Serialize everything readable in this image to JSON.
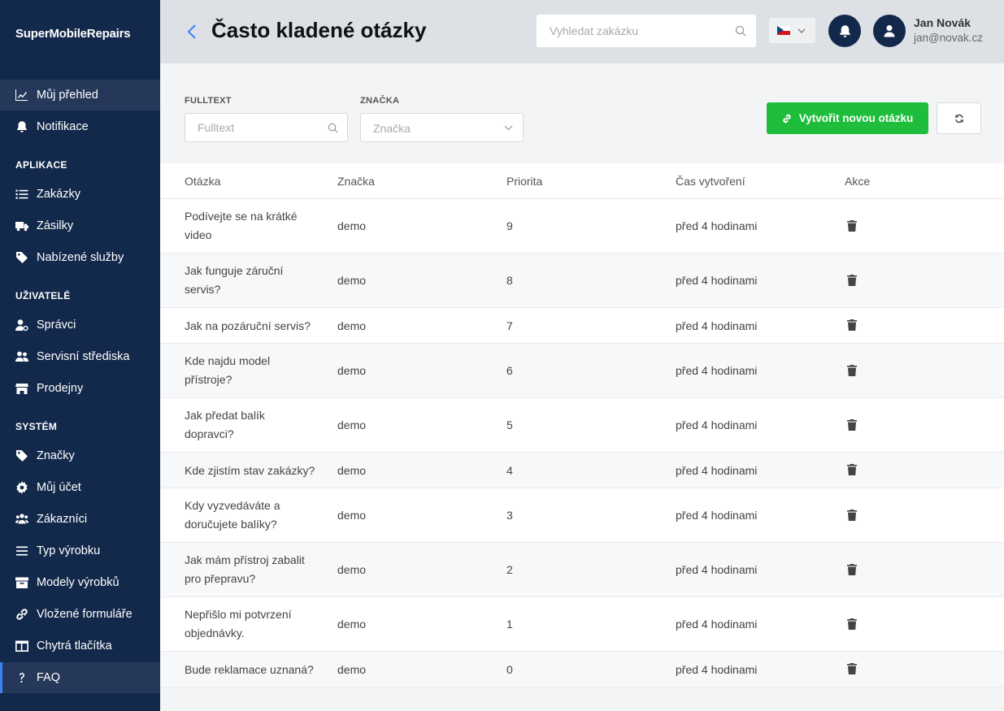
{
  "brand": "SuperMobileRepairs",
  "sidebar": {
    "top_items": [
      {
        "label": "Můj přehled",
        "icon": "chart-line-icon"
      },
      {
        "label": "Notifikace",
        "icon": "bell-icon"
      }
    ],
    "sections": [
      {
        "title": "APLIKACE",
        "items": [
          {
            "label": "Zakázky",
            "icon": "list-icon"
          },
          {
            "label": "Zásilky",
            "icon": "truck-icon"
          },
          {
            "label": "Nabízené služby",
            "icon": "tag-icon"
          }
        ]
      },
      {
        "title": "UŽIVATELÉ",
        "items": [
          {
            "label": "Správci",
            "icon": "user-cog-icon"
          },
          {
            "label": "Servisní střediska",
            "icon": "users-icon"
          },
          {
            "label": "Prodejny",
            "icon": "store-icon"
          }
        ]
      },
      {
        "title": "SYSTÉM",
        "items": [
          {
            "label": "Značky",
            "icon": "tag-icon"
          },
          {
            "label": "Můj účet",
            "icon": "gear-icon"
          },
          {
            "label": "Zákazníci",
            "icon": "users-group-icon"
          },
          {
            "label": "Typ výrobku",
            "icon": "bars-icon"
          },
          {
            "label": "Modely výrobků",
            "icon": "archive-icon"
          },
          {
            "label": "Vložené formuláře",
            "icon": "link-icon"
          },
          {
            "label": "Chytrá tlačítka",
            "icon": "table-icon"
          },
          {
            "label": "FAQ",
            "icon": "question-icon"
          }
        ]
      }
    ]
  },
  "header": {
    "title": "Často kladené otázky",
    "search_placeholder": "Vyhledat zakázku",
    "user_name": "Jan Novák",
    "user_email": "jan@novak.cz"
  },
  "filters": {
    "fulltext_label": "FULLTEXT",
    "fulltext_placeholder": "Fulltext",
    "brand_label": "ZNAČKA",
    "brand_placeholder": "Značka"
  },
  "actions": {
    "create_label": "Vytvořit novou otázku"
  },
  "table": {
    "columns": [
      "Otázka",
      "Značka",
      "Priorita",
      "Čas vytvoření",
      "Akce"
    ],
    "rows": [
      {
        "question_lines": [
          "Podívejte se na krátké",
          "video"
        ],
        "brand": "demo",
        "priority": "9",
        "created": "před 4 hodinami"
      },
      {
        "question_lines": [
          "Jak funguje záruční",
          "servis?"
        ],
        "brand": "demo",
        "priority": "8",
        "created": "před 4 hodinami"
      },
      {
        "question_lines": [
          "Jak na pozáruční servis?"
        ],
        "brand": "demo",
        "priority": "7",
        "created": "před 4 hodinami"
      },
      {
        "question_lines": [
          "Kde najdu model",
          "přístroje?"
        ],
        "brand": "demo",
        "priority": "6",
        "created": "před 4 hodinami"
      },
      {
        "question_lines": [
          "Jak předat balík",
          "dopravci?"
        ],
        "brand": "demo",
        "priority": "5",
        "created": "před 4 hodinami"
      },
      {
        "question_lines": [
          "Kde zjistím stav zakázky?"
        ],
        "brand": "demo",
        "priority": "4",
        "created": "před 4 hodinami"
      },
      {
        "question_lines": [
          "Kdy vyzvedáváte a",
          "doručujete balíky?"
        ],
        "brand": "demo",
        "priority": "3",
        "created": "před 4 hodinami"
      },
      {
        "question_lines": [
          "Jak mám přístroj zabalit",
          "pro přepravu?"
        ],
        "brand": "demo",
        "priority": "2",
        "created": "před 4 hodinami"
      },
      {
        "question_lines": [
          "Nepřišlo mi potvrzení",
          "objednávky."
        ],
        "brand": "demo",
        "priority": "1",
        "created": "před 4 hodinami"
      },
      {
        "question_lines": [
          "Bude reklamace uznaná?"
        ],
        "brand": "demo",
        "priority": "0",
        "created": "před 4 hodinami"
      }
    ]
  }
}
